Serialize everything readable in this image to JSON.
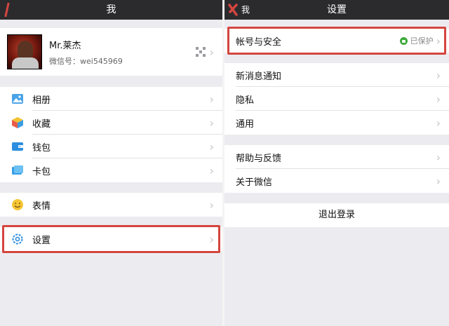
{
  "left": {
    "title": "我",
    "profile": {
      "name": "Mr.莱杰",
      "wechat_id": "微信号：wei545969"
    },
    "group1": [
      {
        "label": "相册",
        "icon": "photo-album-icon"
      },
      {
        "label": "收藏",
        "icon": "favorites-cube-icon"
      },
      {
        "label": "钱包",
        "icon": "wallet-icon"
      },
      {
        "label": "卡包",
        "icon": "card-pack-icon"
      }
    ],
    "group2": [
      {
        "label": "表情",
        "icon": "smiley-icon"
      }
    ],
    "group3": [
      {
        "label": "设置",
        "icon": "settings-gear-icon"
      }
    ]
  },
  "right": {
    "title": "设置",
    "back_label": "我",
    "account": {
      "label": "帐号与安全",
      "status": "已保护"
    },
    "group2": [
      {
        "label": "新消息通知"
      },
      {
        "label": "隐私"
      },
      {
        "label": "通用"
      }
    ],
    "group3": [
      {
        "label": "帮助与反馈"
      },
      {
        "label": "关于微信"
      }
    ],
    "logout": "退出登录"
  },
  "colors": {
    "topbar": "#2b2b2e",
    "highlight": "#d4453f",
    "background": "#ececf0",
    "protected_green": "#3daa3a"
  }
}
